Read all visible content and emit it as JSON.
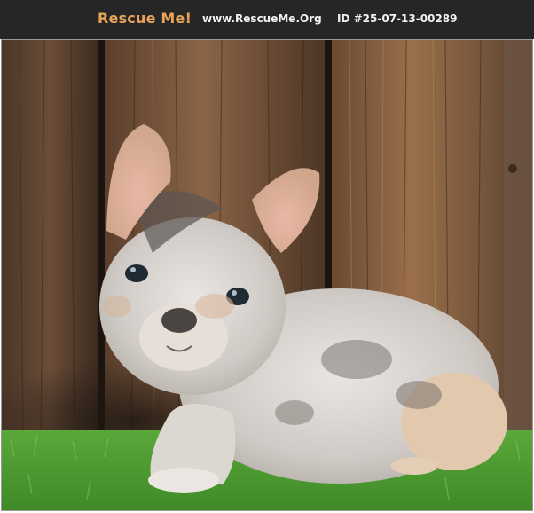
{
  "header": {
    "brand": "Rescue Me!",
    "site": "www.RescueMe.Org",
    "pet_id": "ID #25-07-13-00289"
  },
  "photo": {
    "subject": "dog-photo"
  },
  "colors": {
    "bar": "#262626",
    "brand": "#e8a35a",
    "text": "#f2f2f2",
    "fence_dark": "#3b2a1f",
    "grass": "#4f9a34"
  }
}
